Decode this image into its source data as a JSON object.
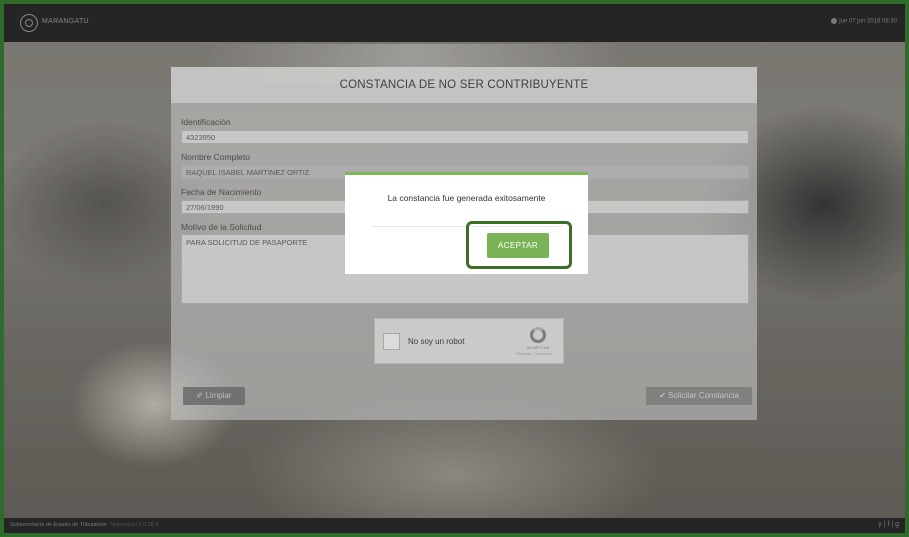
{
  "app": {
    "logo_text": "MARANGATU",
    "clock": "jue 07 jun 2018 08:30"
  },
  "form": {
    "title": "CONSTANCIA DE NO SER CONTRIBUYENTE",
    "fields": [
      {
        "label": "Identificación",
        "value": "4323950"
      },
      {
        "label": "Nombre Completo",
        "value": "RAQUEL ISABEL MARTINEZ  ORTIZ"
      },
      {
        "label": "Fecha de Nacimiento",
        "value": "27/06/1990"
      },
      {
        "label": "Motivo de la Solicitud",
        "value": "PARA SOLICITUD DE PASAPORTE"
      }
    ],
    "captcha": {
      "label": "No soy un robot",
      "brand": "reCAPTCHA",
      "terms": "Privacidad - Condiciones"
    },
    "clear_label": "Limpiar",
    "submit_label": "Solicitar Constancia"
  },
  "modal": {
    "message": "La constancia fue generada exitosamente",
    "accept_label": "ACEPTAR"
  },
  "footer": {
    "org": "Subsecretaría de Estado de Tributación",
    "version": "Marangatu 2.0.38.4",
    "social": "y | f | g"
  },
  "colors": {
    "accent": "#7ab356",
    "highlight": "#3c6e28",
    "topbar": "#2b2b2b"
  }
}
